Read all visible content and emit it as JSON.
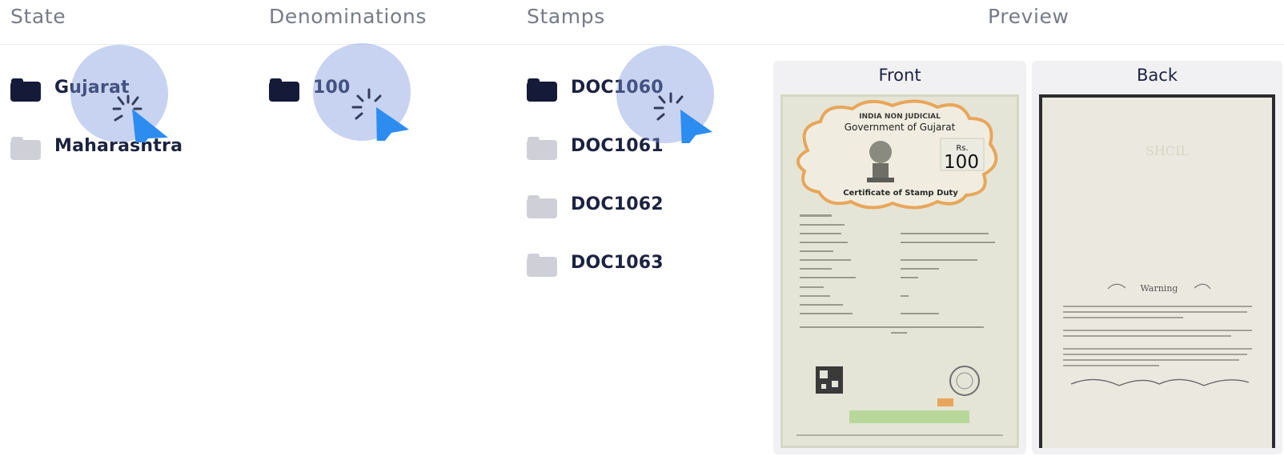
{
  "columns": {
    "state": "State",
    "denominations": "Denominations",
    "stamps": "Stamps",
    "preview": "Preview"
  },
  "states": [
    {
      "label": "Gujarat",
      "selected": true
    },
    {
      "label": "Maharashtra",
      "selected": false
    }
  ],
  "denominations": [
    {
      "label": "100",
      "selected": true
    }
  ],
  "stamps": [
    {
      "label": "DOC1060",
      "selected": true
    },
    {
      "label": "DOC1061",
      "selected": false
    },
    {
      "label": "DOC1062",
      "selected": false
    },
    {
      "label": "DOC1063",
      "selected": false
    }
  ],
  "preview": {
    "front_label": "Front",
    "back_label": "Back",
    "front_doc": {
      "line1": "INDIA NON JUDICIAL",
      "line2": "Government of Gujarat",
      "rs": "Rs.",
      "amount": "100",
      "subtitle": "Certificate of Stamp Duty"
    },
    "back_doc": {
      "watermark": "SHCIL",
      "warning": "Warning"
    }
  },
  "colors": {
    "folder_selected": "#141a37",
    "folder_unselected": "#cfcfd8",
    "click_halo": "#7a96dc",
    "cursor": "#2d8cf0"
  },
  "icons": {
    "folder": "folder-icon",
    "cursor": "cursor-arrow-icon",
    "click": "click-burst-icon"
  }
}
